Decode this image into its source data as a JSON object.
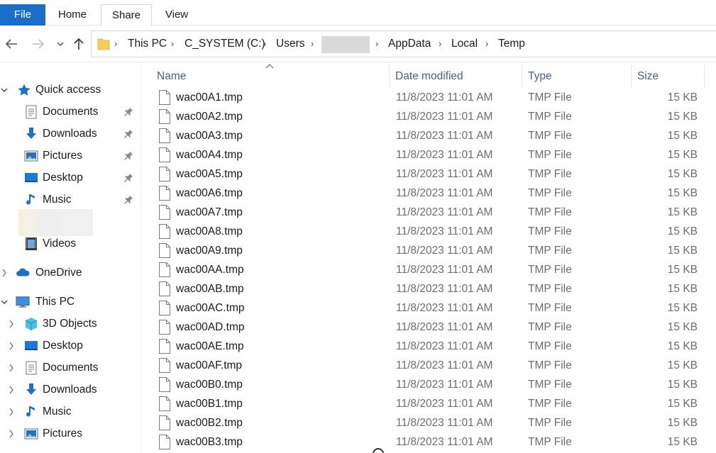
{
  "ribbon": {
    "tabs": [
      {
        "id": "file",
        "label": "File"
      },
      {
        "id": "home",
        "label": "Home"
      },
      {
        "id": "share",
        "label": "Share"
      },
      {
        "id": "view",
        "label": "View"
      }
    ]
  },
  "nav": {
    "back_icon": "arrow-left-icon",
    "forward_icon": "arrow-right-icon",
    "recent_icon": "chevron-down-icon",
    "up_icon": "arrow-up-icon"
  },
  "address": {
    "crumbs": [
      "This PC",
      "C_SYSTEM (C:)",
      "Users",
      "",
      "AppData",
      "Local",
      "Temp"
    ]
  },
  "sidebar": {
    "quick_access": {
      "label": "Quick access",
      "items": [
        {
          "label": "Documents",
          "icon": "documents-icon",
          "pinned": true
        },
        {
          "label": "Downloads",
          "icon": "downloads-icon",
          "pinned": true
        },
        {
          "label": "Pictures",
          "icon": "pictures-icon",
          "pinned": true
        },
        {
          "label": "Desktop",
          "icon": "desktop-icon",
          "pinned": true
        },
        {
          "label": "Music",
          "icon": "music-icon",
          "pinned": true
        },
        {
          "label": "Videos",
          "icon": "videos-icon",
          "pinned": false
        }
      ]
    },
    "onedrive": {
      "label": "OneDrive"
    },
    "this_pc": {
      "label": "This PC",
      "items": [
        {
          "label": "3D Objects",
          "icon": "3d-objects-icon"
        },
        {
          "label": "Desktop",
          "icon": "desktop-icon"
        },
        {
          "label": "Documents",
          "icon": "documents-icon"
        },
        {
          "label": "Downloads",
          "icon": "downloads-icon"
        },
        {
          "label": "Music",
          "icon": "music-icon"
        },
        {
          "label": "Pictures",
          "icon": "pictures-icon"
        }
      ]
    }
  },
  "list": {
    "columns": {
      "name": "Name",
      "date": "Date modified",
      "type": "Type",
      "size": "Size"
    },
    "rows": [
      {
        "name": "wac00A1.tmp",
        "date": "11/8/2023 11:01 AM",
        "type": "TMP File",
        "size": "15 KB"
      },
      {
        "name": "wac00A2.tmp",
        "date": "11/8/2023 11:01 AM",
        "type": "TMP File",
        "size": "15 KB"
      },
      {
        "name": "wac00A3.tmp",
        "date": "11/8/2023 11:01 AM",
        "type": "TMP File",
        "size": "15 KB"
      },
      {
        "name": "wac00A4.tmp",
        "date": "11/8/2023 11:01 AM",
        "type": "TMP File",
        "size": "15 KB"
      },
      {
        "name": "wac00A5.tmp",
        "date": "11/8/2023 11:01 AM",
        "type": "TMP File",
        "size": "15 KB"
      },
      {
        "name": "wac00A6.tmp",
        "date": "11/8/2023 11:01 AM",
        "type": "TMP File",
        "size": "15 KB"
      },
      {
        "name": "wac00A7.tmp",
        "date": "11/8/2023 11:01 AM",
        "type": "TMP File",
        "size": "15 KB"
      },
      {
        "name": "wac00A8.tmp",
        "date": "11/8/2023 11:01 AM",
        "type": "TMP File",
        "size": "15 KB"
      },
      {
        "name": "wac00A9.tmp",
        "date": "11/8/2023 11:01 AM",
        "type": "TMP File",
        "size": "15 KB"
      },
      {
        "name": "wac00AA.tmp",
        "date": "11/8/2023 11:01 AM",
        "type": "TMP File",
        "size": "15 KB"
      },
      {
        "name": "wac00AB.tmp",
        "date": "11/8/2023 11:01 AM",
        "type": "TMP File",
        "size": "15 KB"
      },
      {
        "name": "wac00AC.tmp",
        "date": "11/8/2023 11:01 AM",
        "type": "TMP File",
        "size": "15 KB"
      },
      {
        "name": "wac00AD.tmp",
        "date": "11/8/2023 11:01 AM",
        "type": "TMP File",
        "size": "15 KB"
      },
      {
        "name": "wac00AE.tmp",
        "date": "11/8/2023 11:01 AM",
        "type": "TMP File",
        "size": "15 KB"
      },
      {
        "name": "wac00AF.tmp",
        "date": "11/8/2023 11:01 AM",
        "type": "TMP File",
        "size": "15 KB"
      },
      {
        "name": "wac00B0.tmp",
        "date": "11/8/2023 11:01 AM",
        "type": "TMP File",
        "size": "15 KB"
      },
      {
        "name": "wac00B1.tmp",
        "date": "11/8/2023 11:01 AM",
        "type": "TMP File",
        "size": "15 KB"
      },
      {
        "name": "wac00B2.tmp",
        "date": "11/8/2023 11:01 AM",
        "type": "TMP File",
        "size": "15 KB"
      },
      {
        "name": "wac00B3.tmp",
        "date": "11/8/2023 11:01 AM",
        "type": "TMP File",
        "size": "15 KB"
      }
    ]
  },
  "colors": {
    "file_tab": "#1a6ec9",
    "header_text": "#4c607a",
    "secondary_text": "#6d6d6d",
    "quick_access_star": "#1a73c8"
  }
}
